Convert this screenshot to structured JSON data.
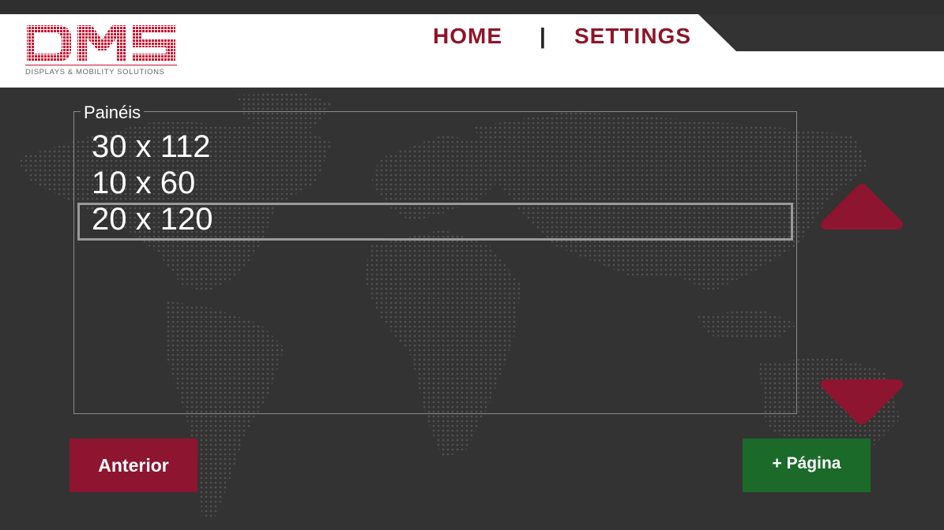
{
  "header": {
    "logo_text": "DMS",
    "logo_subtitle": "DISPLAYS & MOBILITY SOLUTIONS",
    "nav": {
      "home": "HOME",
      "separator": "|",
      "settings": "SETTINGS"
    }
  },
  "panel": {
    "legend": "Painéis",
    "items": [
      "30 x 112",
      "10 x 60",
      "20 x 120"
    ],
    "selected_index": 2
  },
  "controls": {
    "up_icon": "triangle-up-icon",
    "down_icon": "triangle-down-icon",
    "prev_label": "Anterior",
    "next_label": "+ Página"
  },
  "colors": {
    "brand_red": "#8e1428",
    "arrow_red": "#8e1530",
    "next_green": "#1b6a2a",
    "background": "#333333"
  }
}
